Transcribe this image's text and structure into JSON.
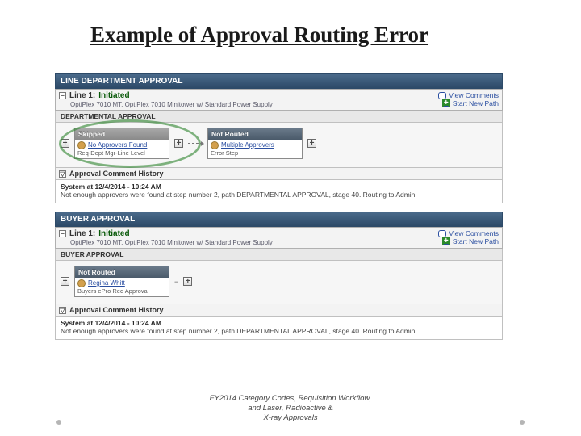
{
  "title": "Example of Approval Routing Error",
  "sections": {
    "lineDept": {
      "header": "LINE DEPARTMENT APPROVAL",
      "line": {
        "label": "Line 1:",
        "status": "Initiated",
        "desc": "OptiPlex 7010 MT, OptiPlex 7010 Minitower w/ Standard Power Supply"
      },
      "actions": {
        "view": "View Comments",
        "start": "Start New Path"
      },
      "subHeader": "DEPARTMENTAL APPROVAL",
      "steps": {
        "skipped": {
          "title": "Skipped",
          "line1": "No Approvers Found",
          "line2": "Req-Dept Mgr-Line Level"
        },
        "notRouted": {
          "title": "Not Routed",
          "line1": "Multiple Approvers",
          "line2": "Error Step"
        }
      },
      "commentHdr": "Approval Comment History",
      "comment": {
        "who": "System at 12/4/2014 - 10:24 AM",
        "text": "Not enough approvers were found at step number 2, path DEPARTMENTAL APPROVAL, stage 40. Routing to Admin."
      }
    },
    "buyer": {
      "header": "BUYER APPROVAL",
      "line": {
        "label": "Line 1:",
        "status": "Initiated",
        "desc": "OptiPlex 7010 MT, OptiPlex 7010 Minitower w/ Standard Power Supply"
      },
      "actions": {
        "view": "View Comments",
        "start": "Start New Path"
      },
      "subHeader": "BUYER APPROVAL",
      "steps": {
        "notRouted": {
          "title": "Not Routed",
          "line1": "Regina Whitt",
          "line2": "Buyers ePro Req Approval"
        }
      },
      "commentHdr": "Approval Comment History",
      "comment": {
        "who": "System at 12/4/2014 - 10:24 AM",
        "text": "Not enough approvers were found at step number 2, path DEPARTMENTAL APPROVAL, stage 40. Routing to Admin."
      }
    }
  },
  "footer": {
    "l1": "FY2014 Category Codes, Requisition Workflow,",
    "l2": "and Laser, Radioactive &",
    "l3": "X-ray Approvals"
  }
}
